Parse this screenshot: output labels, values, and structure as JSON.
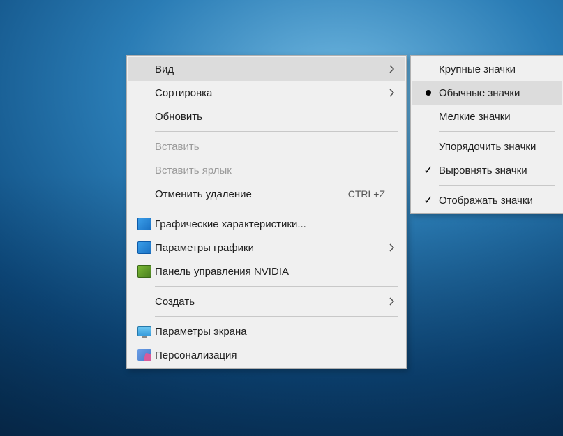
{
  "mainMenu": {
    "items": [
      {
        "label": "Вид",
        "hasSubmenu": true,
        "hover": true
      },
      {
        "label": "Сортировка",
        "hasSubmenu": true
      },
      {
        "label": "Обновить"
      }
    ],
    "group2": [
      {
        "label": "Вставить",
        "disabled": true
      },
      {
        "label": "Вставить ярлык",
        "disabled": true
      },
      {
        "label": "Отменить удаление",
        "shortcut": "CTRL+Z"
      }
    ],
    "group3": [
      {
        "label": "Графические характеристики...",
        "icon": "intel-graphics-icon"
      },
      {
        "label": "Параметры графики",
        "icon": "intel-graphics-icon",
        "hasSubmenu": true
      },
      {
        "label": "Панель управления NVIDIA",
        "icon": "nvidia-icon"
      }
    ],
    "group4": [
      {
        "label": "Создать",
        "hasSubmenu": true
      }
    ],
    "group5": [
      {
        "label": "Параметры экрана",
        "icon": "monitor-icon"
      },
      {
        "label": "Персонализация",
        "icon": "personalize-icon"
      }
    ]
  },
  "subMenu": {
    "group1": [
      {
        "label": "Крупные значки"
      },
      {
        "label": "Обычные значки",
        "radio": true,
        "hover": true
      },
      {
        "label": "Мелкие значки"
      }
    ],
    "group2": [
      {
        "label": "Упорядочить значки"
      },
      {
        "label": "Выровнять значки",
        "checked": true
      }
    ],
    "group3": [
      {
        "label": "Отображать значки",
        "checked": true
      }
    ]
  }
}
